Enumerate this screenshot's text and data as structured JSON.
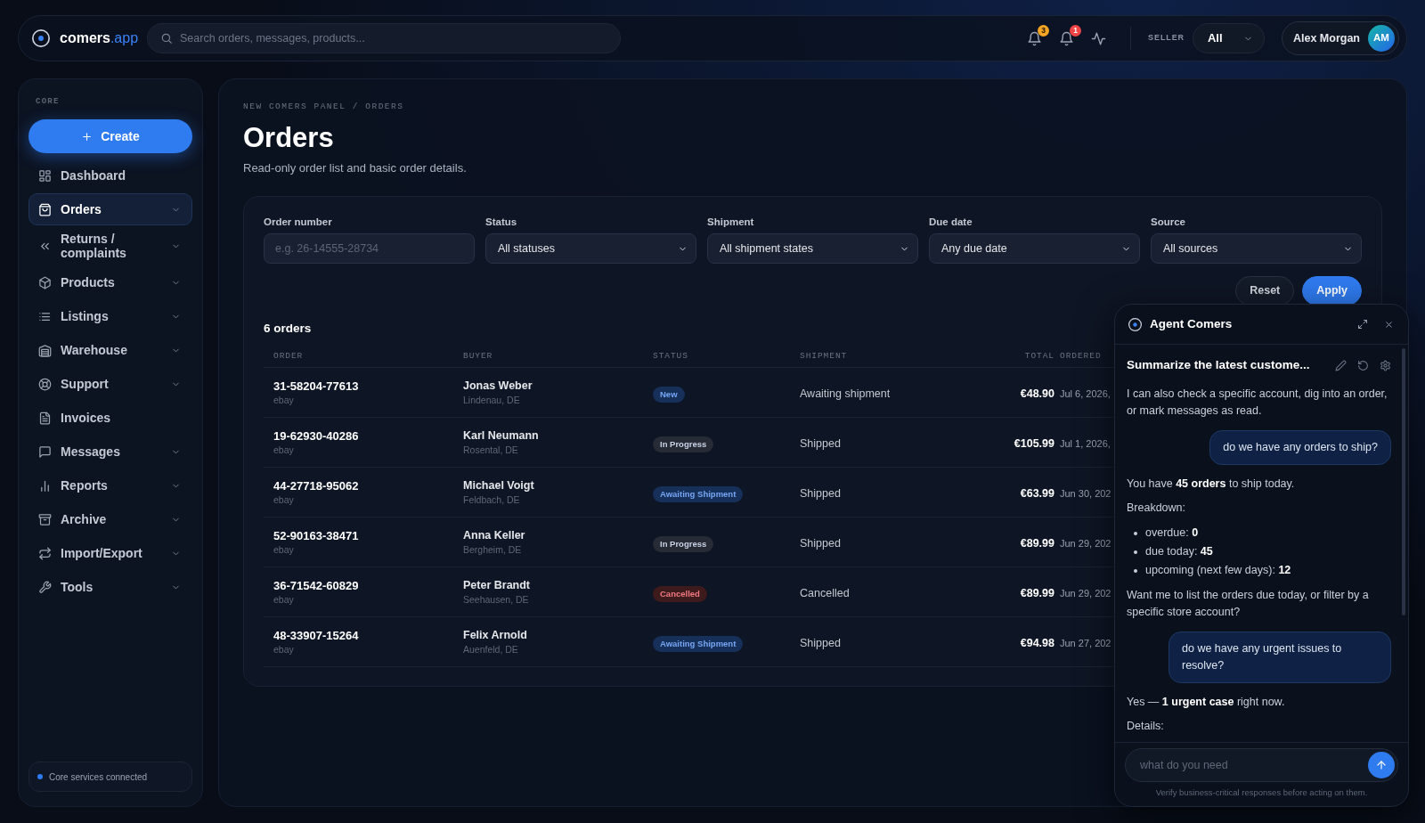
{
  "topbar": {
    "logo": {
      "name": "comers",
      "suffix": ".app"
    },
    "search": {
      "placeholder": "Search orders, messages, products..."
    },
    "notifications": [
      {
        "count": "3",
        "color": "#f5a524"
      },
      {
        "count": "1",
        "color": "#ef4444"
      }
    ],
    "seller": {
      "label": "SELLER",
      "value": "All"
    },
    "user": {
      "name": "Alex Morgan",
      "initials": "AM"
    }
  },
  "sidebar": {
    "section": "CORE",
    "create_button": "Create",
    "items": [
      {
        "label": "Dashboard",
        "selected": false,
        "expandable": false
      },
      {
        "label": "Orders",
        "selected": true,
        "expandable": true
      },
      {
        "label": "Returns / complaints",
        "selected": false,
        "expandable": true
      },
      {
        "label": "Products",
        "selected": false,
        "expandable": true
      },
      {
        "label": "Listings",
        "selected": false,
        "expandable": true
      },
      {
        "label": "Warehouse",
        "selected": false,
        "expandable": true
      },
      {
        "label": "Support",
        "selected": false,
        "expandable": true
      },
      {
        "label": "Invoices",
        "selected": false,
        "expandable": false
      },
      {
        "label": "Messages",
        "selected": false,
        "expandable": true
      },
      {
        "label": "Reports",
        "selected": false,
        "expandable": true
      },
      {
        "label": "Archive",
        "selected": false,
        "expandable": true
      },
      {
        "label": "Import/Export",
        "selected": false,
        "expandable": true
      },
      {
        "label": "Tools",
        "selected": false,
        "expandable": true
      }
    ],
    "status": "Core services connected"
  },
  "page": {
    "breadcrumb": "NEW COMERS PANEL / ORDERS",
    "title": "Orders",
    "subtitle": "Read-only order list and basic order details."
  },
  "filters": {
    "fields": [
      {
        "label": "Order number",
        "kind": "input",
        "placeholder": "e.g. 26-14555-28734"
      },
      {
        "label": "Status",
        "kind": "select",
        "value": "All statuses"
      },
      {
        "label": "Shipment",
        "kind": "select",
        "value": "All shipment states"
      },
      {
        "label": "Due date",
        "kind": "select",
        "value": "Any due date"
      },
      {
        "label": "Source",
        "kind": "select",
        "value": "All sources"
      }
    ],
    "buttons": [
      {
        "label": "Reset",
        "kind": "secondary"
      },
      {
        "label": "Apply",
        "kind": "primary"
      }
    ]
  },
  "orders": {
    "count": "6 orders",
    "columns": [
      "ORDER",
      "BUYER",
      "STATUS",
      "SHIPMENT",
      "TOTAL",
      "ORDERED"
    ],
    "rows": [
      {
        "order": "31-58204-77613",
        "source": "ebay",
        "buyer": "Jonas Weber",
        "location": "Lindenau, DE",
        "status": {
          "label": "New",
          "color": "#16305a"
        },
        "shipment": "Awaiting shipment",
        "total": "€48.90",
        "ordered": "Jul 6, 2026,"
      },
      {
        "order": "19-62930-40286",
        "source": "ebay",
        "buyer": "Karl Neumann",
        "location": "Rosental, DE",
        "status": {
          "label": "In Progress",
          "color": "#262b35"
        },
        "shipment": "Shipped",
        "total": "€105.99",
        "ordered": "Jul 1, 2026,"
      },
      {
        "order": "44-27718-95062",
        "source": "ebay",
        "buyer": "Michael Voigt",
        "location": "Feldbach, DE",
        "status": {
          "label": "Awaiting Shipment",
          "color": "#16305a"
        },
        "shipment": "Shipped",
        "total": "€63.99",
        "ordered": "Jun 30, 202"
      },
      {
        "order": "52-90163-38471",
        "source": "ebay",
        "buyer": "Anna Keller",
        "location": "Bergheim, DE",
        "status": {
          "label": "In Progress",
          "color": "#262b35"
        },
        "shipment": "Shipped",
        "total": "€89.99",
        "ordered": "Jun 29, 202"
      },
      {
        "order": "36-71542-60829",
        "source": "ebay",
        "buyer": "Peter Brandt",
        "location": "Seehausen, DE",
        "status": {
          "label": "Cancelled",
          "color": "#3d1a1c"
        },
        "shipment": "Cancelled",
        "total": "€89.99",
        "ordered": "Jun 29, 202"
      },
      {
        "order": "48-33907-15264",
        "source": "ebay",
        "buyer": "Felix Arnold",
        "location": "Auenfeld, DE",
        "status": {
          "label": "Awaiting Shipment",
          "color": "#16305a"
        },
        "shipment": "Shipped",
        "total": "€94.98",
        "ordered": "Jun 27, 202"
      }
    ]
  },
  "agent": {
    "title": "Agent Comers",
    "conversation_title": "Summarize the latest custome...",
    "messages": [
      {
        "kind": "assistant",
        "blocks": [
          {
            "kind": "text",
            "text": "I can also check a specific account, dig into an order, or mark messages as read."
          }
        ]
      },
      {
        "kind": "user",
        "text": "do we have any orders to ship?"
      },
      {
        "kind": "assistant",
        "blocks": [
          {
            "kind": "text",
            "text": "You have **45 orders** to ship today."
          },
          {
            "kind": "text",
            "text": "Breakdown:"
          },
          {
            "kind": "list",
            "items": [
              "overdue: **0**",
              "due today: **45**",
              "upcoming (next few days): **12**"
            ]
          },
          {
            "kind": "text",
            "text": "Want me to list the orders due today, or filter by a specific store account?"
          }
        ]
      },
      {
        "kind": "user",
        "text": "do we have any urgent issues to resolve?"
      },
      {
        "kind": "assistant",
        "blocks": [
          {
            "kind": "text",
            "text": "Yes — **1 urgent case** right now."
          },
          {
            "kind": "text",
            "text": "Details:"
          }
        ]
      }
    ],
    "input": {
      "placeholder": "what do you need"
    },
    "disclaimer": "Verify business-critical responses before acting on them."
  }
}
